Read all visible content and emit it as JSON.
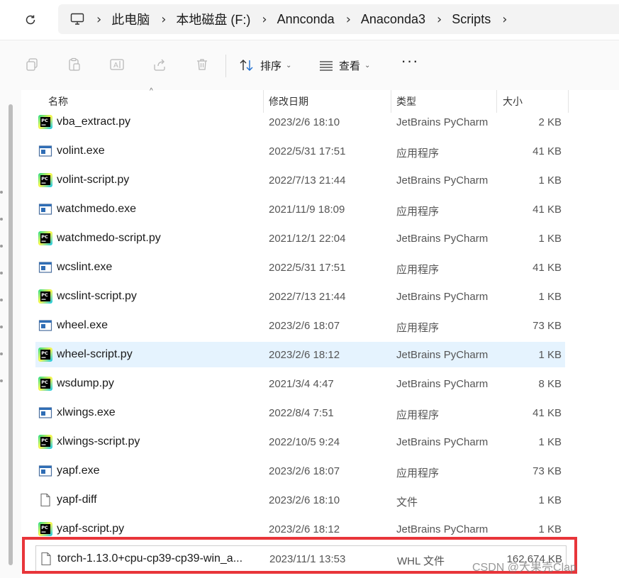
{
  "address_bar": {
    "breadcrumbs": [
      "此电脑",
      "本地磁盘 (F:)",
      "Annconda",
      "Anaconda3",
      "Scripts"
    ]
  },
  "toolbar": {
    "sort_label": "排序",
    "view_label": "查看",
    "more_label": "···"
  },
  "columns": {
    "name": "名称",
    "date": "修改日期",
    "type": "类型",
    "size": "大小"
  },
  "files": [
    {
      "name": "vba_extract.py",
      "date": "2023/2/6 18:10",
      "type": "JetBrains PyCharm",
      "size": "2 KB",
      "icon": "pycharm-icon"
    },
    {
      "name": "volint.exe",
      "date": "2022/5/31 17:51",
      "type": "应用程序",
      "size": "41 KB",
      "icon": "exe-icon"
    },
    {
      "name": "volint-script.py",
      "date": "2022/7/13 21:44",
      "type": "JetBrains PyCharm",
      "size": "1 KB",
      "icon": "pycharm-icon"
    },
    {
      "name": "watchmedo.exe",
      "date": "2021/11/9 18:09",
      "type": "应用程序",
      "size": "41 KB",
      "icon": "exe-icon"
    },
    {
      "name": "watchmedo-script.py",
      "date": "2021/12/1 22:04",
      "type": "JetBrains PyCharm",
      "size": "1 KB",
      "icon": "pycharm-icon"
    },
    {
      "name": "wcslint.exe",
      "date": "2022/5/31 17:51",
      "type": "应用程序",
      "size": "41 KB",
      "icon": "exe-icon"
    },
    {
      "name": "wcslint-script.py",
      "date": "2022/7/13 21:44",
      "type": "JetBrains PyCharm",
      "size": "1 KB",
      "icon": "pycharm-icon"
    },
    {
      "name": "wheel.exe",
      "date": "2023/2/6 18:07",
      "type": "应用程序",
      "size": "73 KB",
      "icon": "exe-icon"
    },
    {
      "name": "wheel-script.py",
      "date": "2023/2/6 18:12",
      "type": "JetBrains PyCharm",
      "size": "1 KB",
      "icon": "pycharm-icon",
      "selected": true
    },
    {
      "name": "wsdump.py",
      "date": "2021/3/4 4:47",
      "type": "JetBrains PyCharm",
      "size": "8 KB",
      "icon": "pycharm-icon"
    },
    {
      "name": "xlwings.exe",
      "date": "2022/8/4 7:51",
      "type": "应用程序",
      "size": "41 KB",
      "icon": "exe-icon"
    },
    {
      "name": "xlwings-script.py",
      "date": "2022/10/5 9:24",
      "type": "JetBrains PyCharm",
      "size": "1 KB",
      "icon": "pycharm-icon"
    },
    {
      "name": "yapf.exe",
      "date": "2023/2/6 18:07",
      "type": "应用程序",
      "size": "73 KB",
      "icon": "exe-icon"
    },
    {
      "name": "yapf-diff",
      "date": "2023/2/6 18:10",
      "type": "文件",
      "size": "1 KB",
      "icon": "file-icon"
    },
    {
      "name": "yapf-script.py",
      "date": "2023/2/6 18:12",
      "type": "JetBrains PyCharm",
      "size": "1 KB",
      "icon": "pycharm-icon"
    },
    {
      "name": "torch-1.13.0+cpu-cp39-cp39-win_a...",
      "date": "2023/11/1 13:53",
      "type": "WHL 文件",
      "size": "162,674 KB",
      "icon": "file-icon",
      "highlighted": true
    }
  ],
  "watermark": "CSDN @大果壳Clap",
  "colors": {
    "selected_row": "#e5f3fe",
    "annotation_box": "#e8353a"
  }
}
